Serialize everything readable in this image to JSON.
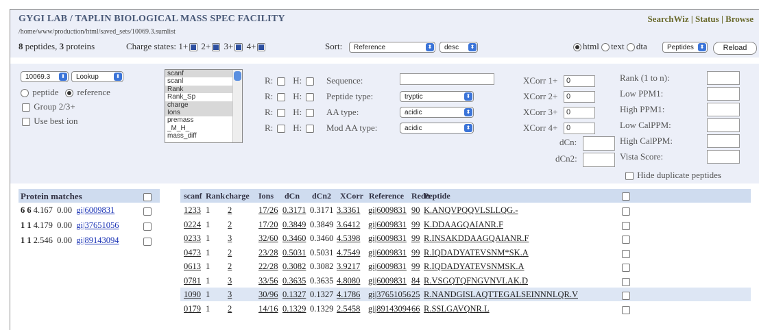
{
  "header": {
    "title": "GYGI LAB / TAPLIN BIOLOGICAL MASS SPEC FACILITY",
    "path": "/home/www/production/html/saved_sets/10069.3.sumlist",
    "peptide_count": "8",
    "peptides_word": "peptides,",
    "protein_count": "3",
    "proteins_word": "proteins",
    "nav": {
      "searchwiz": "SearchWiz",
      "status": "Status",
      "browse": "Browse",
      "sep": "|"
    }
  },
  "charge_states": {
    "label": "Charge states:",
    "options": [
      "1+",
      "2+",
      "3+",
      "4+"
    ]
  },
  "sort": {
    "label": "Sort:",
    "field": "Reference",
    "order": "desc"
  },
  "format": {
    "options": [
      "html",
      "text",
      "dta"
    ],
    "selected": "html",
    "view": "Peptides",
    "reload": "Reload"
  },
  "controls": {
    "set_select": "10069.3",
    "action_select": "Lookup",
    "mode_peptide": "peptide",
    "mode_reference": "reference",
    "group_label": "Group 2/3+",
    "best_ion_label": "Use best ion",
    "columns": [
      "scanf",
      "scanl",
      "Rank",
      "Rank_Sp",
      "charge",
      "Ions",
      "premass",
      "_M_H_",
      "mass_diff"
    ],
    "highlighted": [
      0,
      2,
      4,
      5
    ],
    "r_label": "R:",
    "h_label": "H:",
    "sequence_label": "Sequence:",
    "peptide_type_label": "Peptide type:",
    "peptide_type": "tryptic",
    "aa_type_label": "AA type:",
    "aa_type": "acidic",
    "mod_aa_type_label": "Mod AA type:",
    "mod_aa_type": "acidic",
    "xcorr": [
      {
        "label": "XCorr 1+",
        "value": "0"
      },
      {
        "label": "XCorr 2+",
        "value": "0"
      },
      {
        "label": "XCorr 3+",
        "value": "0"
      },
      {
        "label": "XCorr 4+",
        "value": "0"
      }
    ],
    "dcn_label": "dCn:",
    "dcn2_label": "dCn2:",
    "filters": [
      "Rank (1 to n):",
      "Low PPM1:",
      "High PPM1:",
      "Low CalPPM:",
      "High CalPPM:",
      "Vista Score:"
    ],
    "hide_dup": "Hide duplicate peptides"
  },
  "protein_matches": {
    "title": "Protein matches",
    "rows": [
      {
        "a": "6",
        "b": "6",
        "score": "4.167",
        "v": "0.00",
        "ref": "gi|6009831"
      },
      {
        "a": "1",
        "b": "1",
        "score": "4.179",
        "v": "0.00",
        "ref": "gi|37651056"
      },
      {
        "a": "1",
        "b": "1",
        "score": "2.546",
        "v": "0.00",
        "ref": "gi|89143094"
      }
    ]
  },
  "peptides": {
    "headers": [
      "scanf",
      "Rank",
      "charge",
      "Ions",
      "dCn",
      "dCn2",
      "XCorr",
      "Reference",
      "Redu",
      "Peptide"
    ],
    "rows": [
      {
        "scanf": "1233",
        "rank": "1",
        "charge": "2",
        "ions": "17/26",
        "dcn": "0.3171",
        "dcn2": "0.3171",
        "xcorr": "3.3361",
        "ref": "gi|6009831",
        "redu": "90",
        "pep": "K.ANQVPQQVLSLLQG.-"
      },
      {
        "scanf": "0224",
        "rank": "1",
        "charge": "2",
        "ions": "17/20",
        "dcn": "0.3849",
        "dcn2": "0.3849",
        "xcorr": "3.6412",
        "ref": "gi|6009831",
        "redu": "99",
        "pep": "K.DDAAGQAIANR.F"
      },
      {
        "scanf": "0233",
        "rank": "1",
        "charge": "3",
        "ions": "32/60",
        "dcn": "0.3460",
        "dcn2": "0.3460",
        "xcorr": "4.5398",
        "ref": "gi|6009831",
        "redu": "99",
        "pep": "R.INSAKDDAAGQAIANR.F"
      },
      {
        "scanf": "0473",
        "rank": "1",
        "charge": "2",
        "ions": "23/28",
        "dcn": "0.5031",
        "dcn2": "0.5031",
        "xcorr": "4.7549",
        "ref": "gi|6009831",
        "redu": "99",
        "pep": "R.IQDADYATEVSNM*SK.A"
      },
      {
        "scanf": "0613",
        "rank": "1",
        "charge": "2",
        "ions": "22/28",
        "dcn": "0.3082",
        "dcn2": "0.3082",
        "xcorr": "3.9217",
        "ref": "gi|6009831",
        "redu": "99",
        "pep": "R.IQDADYATEVSNMSK.A"
      },
      {
        "scanf": "0781",
        "rank": "1",
        "charge": "3",
        "ions": "33/56",
        "dcn": "0.3635",
        "dcn2": "0.3635",
        "xcorr": "4.8080",
        "ref": "gi|6009831",
        "redu": "84",
        "pep": "R.VSGQTQFNGVNVLAK.D"
      },
      {
        "scanf": "1090",
        "rank": "1",
        "charge": "3",
        "ions": "30/96",
        "dcn": "0.1327",
        "dcn2": "0.1327",
        "xcorr": "4.1786",
        "ref": "gi|37651056",
        "redu": "25",
        "pep": "R.NANDGISLAQTTEGALSEINNNLQR.V"
      },
      {
        "scanf": "0179",
        "rank": "1",
        "charge": "2",
        "ions": "14/16",
        "dcn": "0.1329",
        "dcn2": "0.1329",
        "xcorr": "2.5458",
        "ref": "gi|89143094",
        "redu": "66",
        "pep": "R.SSLGAVQNR.L"
      }
    ]
  },
  "colors": {
    "band": "#eceff8",
    "header": "#cfdcef",
    "link": "#1a33b5",
    "xcorr": "#d83aa8",
    "nav": "#6b6b2e"
  }
}
